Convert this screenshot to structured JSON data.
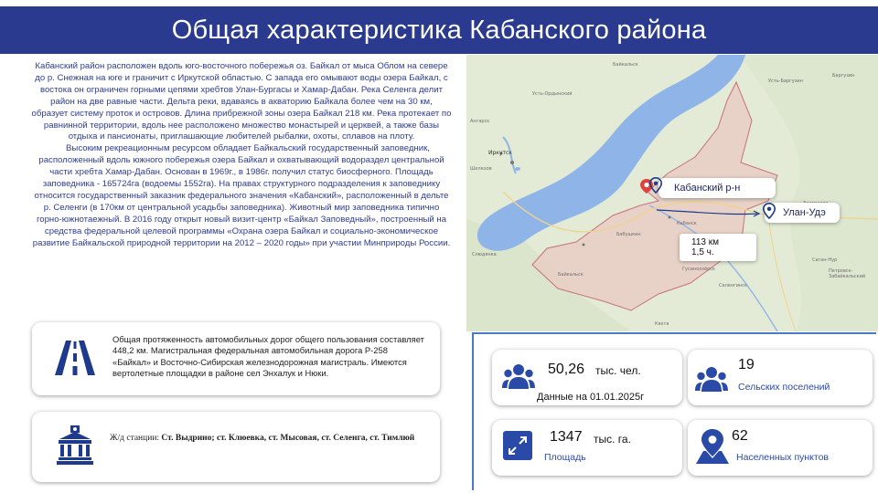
{
  "title": "Общая характеристика  Кабанского района",
  "description": {
    "paragraph1": "Кабанский район расположен вдоль юго-восточного побережья оз. Байкал от мыса Облом на севере до р. Снежная на юге и граничит с Иркутской областью. С запада его омывают воды озера Байкал, с востока он ограничен горными цепями хребтов Улан-Бургасы и Хамар-Дабан. Река Селенга делит район на две равные части. Дельта реки, вдаваясь в акваторию Байкала более чем на 30 км, образует систему проток и островов. Длина прибрежной зоны озера Байкал 218 км. Река  протекает по равнинной территории, вдоль нее расположено множество монастырей и церквей, а также базы отдыха и пансионаты, приглашающие  любителей рыбалки, охоты, сплавов на плоту.",
    "paragraph2": "Высоким рекреационным ресурсом обладает Байкальский государственный заповедник, расположенный вдоль южного побережья озера Байкал и охватывающий водораздел центральной части хребта Хамар-Дабан. Основан в 1969г., в 1986г. получил статус биосферного. Площадь заповедника - 165724га (водоемы 1552га). На правах структурного подразделения к заповеднику относится государственный заказник федерального значения «Кабанский», расположенный в дельте р. Селенги (в 170км от центральной усадьбы заповедника). Животный мир заповедника типично горно-южнотаежный. В 2016 году открыт новый визит-центр «Байкал Заповедный», построенный на средства федеральной целевой программы «Охрана озера Байкал и социально-экономическое развитие Байкальской природной территории на 2012 – 2020 годы» при участии Минприроды России."
  },
  "map": {
    "callout_kabansky": "Кабанский р-н",
    "callout_ulan_ude": "Улан-Удэ",
    "distance_km": "113 км",
    "distance_time": "1,5 ч.",
    "labels": {
      "baikalsk_north": "Байкальск",
      "ust_ordynsky": "Усть-Ордынский",
      "irkutsk": "Иркутск",
      "angarsk": "Ангарск",
      "shelekhov": "Шелехов",
      "slyudyanka": "Слюдянка",
      "baikalsk": "Байкальск",
      "babushkin": "Бабушкин",
      "kabansk": "Кабанск",
      "zaigraevo": "Заиграево",
      "gusinoozersk": "Гусиноозёрск",
      "selenginsk": "Селенгинск",
      "sagan_nur": "Саган-Нур",
      "petrovsk": "Петровск-Забайкальский",
      "barguzin": "Баргузин",
      "ust_barguzin": "Усть-Баргузин",
      "kyakhta": "Кяхта"
    },
    "colors": {
      "lake": "#8fb5e8",
      "land": "#e3ebd6",
      "district_fill": "#e9c9c1",
      "border": "#c9707a",
      "pin": "#1e3a8c"
    }
  },
  "info": {
    "roads_text": "Общая протяженность автомобильных дорог общего пользования составляет 448,2 км. Магистральная федеральная автомобильная дорога Р-258 «Байкал» и Восточно-Сибирская железнодорожная магистраль. Имеются вертолетные площадки в районе сел Энхалук и Нюки.",
    "rail_label": "Ж/д станции:",
    "rail_value": "Ст. Выдрино; ст. Клюевка, ст. Мысовая, ст. Селенга, ст. Тимлюй",
    "roads_icon": "road-icon",
    "rail_icon": "railway-station-icon"
  },
  "stats": {
    "population_value": "50,26",
    "population_unit": "тыс. чел.",
    "population_note": "Данные на 01.01.2025г",
    "rural_value": "19",
    "rural_label": "Сельских поселений",
    "area_value": "1347",
    "area_unit": "тыс. га.",
    "area_label": "Площадь",
    "places_value": "62",
    "places_label": "Населенных пунктов",
    "accent_color": "#2a4aa8",
    "icons": [
      "people-icon",
      "people-icon",
      "expand-arrows-icon",
      "map-pin-icon"
    ]
  }
}
